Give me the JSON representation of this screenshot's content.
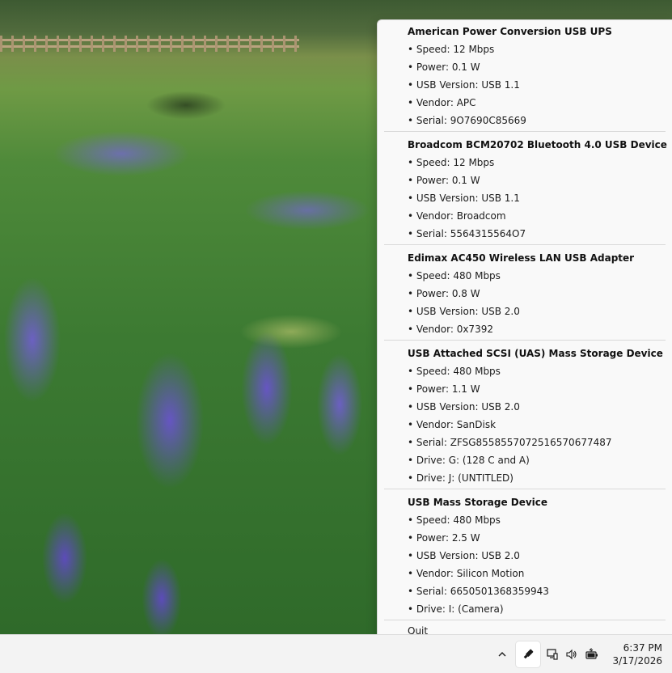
{
  "devices": [
    {
      "name": "American Power Conversion USB UPS",
      "details": [
        "• Speed: 12 Mbps",
        "• Power: 0.1 W",
        "• USB Version: USB 1.1",
        "• Vendor: APC",
        "• Serial: 9O7690C85669"
      ]
    },
    {
      "name": "Broadcom BCM20702 Bluetooth 4.0 USB Device",
      "details": [
        "• Speed: 12 Mbps",
        "• Power: 0.1 W",
        "• USB Version: USB 1.1",
        "• Vendor: Broadcom",
        "• Serial: 5564315564O7"
      ]
    },
    {
      "name": "Edimax AC450 Wireless LAN USB Adapter",
      "details": [
        "• Speed: 480 Mbps",
        "• Power: 0.8 W",
        "• USB Version: USB 2.0",
        "• Vendor: 0x7392"
      ]
    },
    {
      "name": "USB Attached SCSI (UAS) Mass Storage Device",
      "details": [
        "• Speed: 480 Mbps",
        "• Power: 1.1 W",
        "• USB Version: USB 2.0",
        "• Vendor: SanDisk",
        "• Serial: ZFSG8558557072516570677487",
        "• Drive: G: (128 C and A)",
        "• Drive: J: (UNTITLED)"
      ]
    },
    {
      "name": "USB Mass Storage Device",
      "details": [
        "• Speed: 480 Mbps",
        "• Power: 2.5 W",
        "• USB Version: USB 2.0",
        "• Vendor: Silicon Motion",
        "• Serial: 6650501368359943",
        "• Drive: I: (Camera)"
      ]
    }
  ],
  "menu": {
    "quit_label": "Quit"
  },
  "taskbar": {
    "time": "6:37 PM",
    "date": "3/17/2026",
    "icons": [
      "chevron-up-icon",
      "usb-stick-icon",
      "network-icon",
      "speaker-icon",
      "battery-icon"
    ]
  }
}
